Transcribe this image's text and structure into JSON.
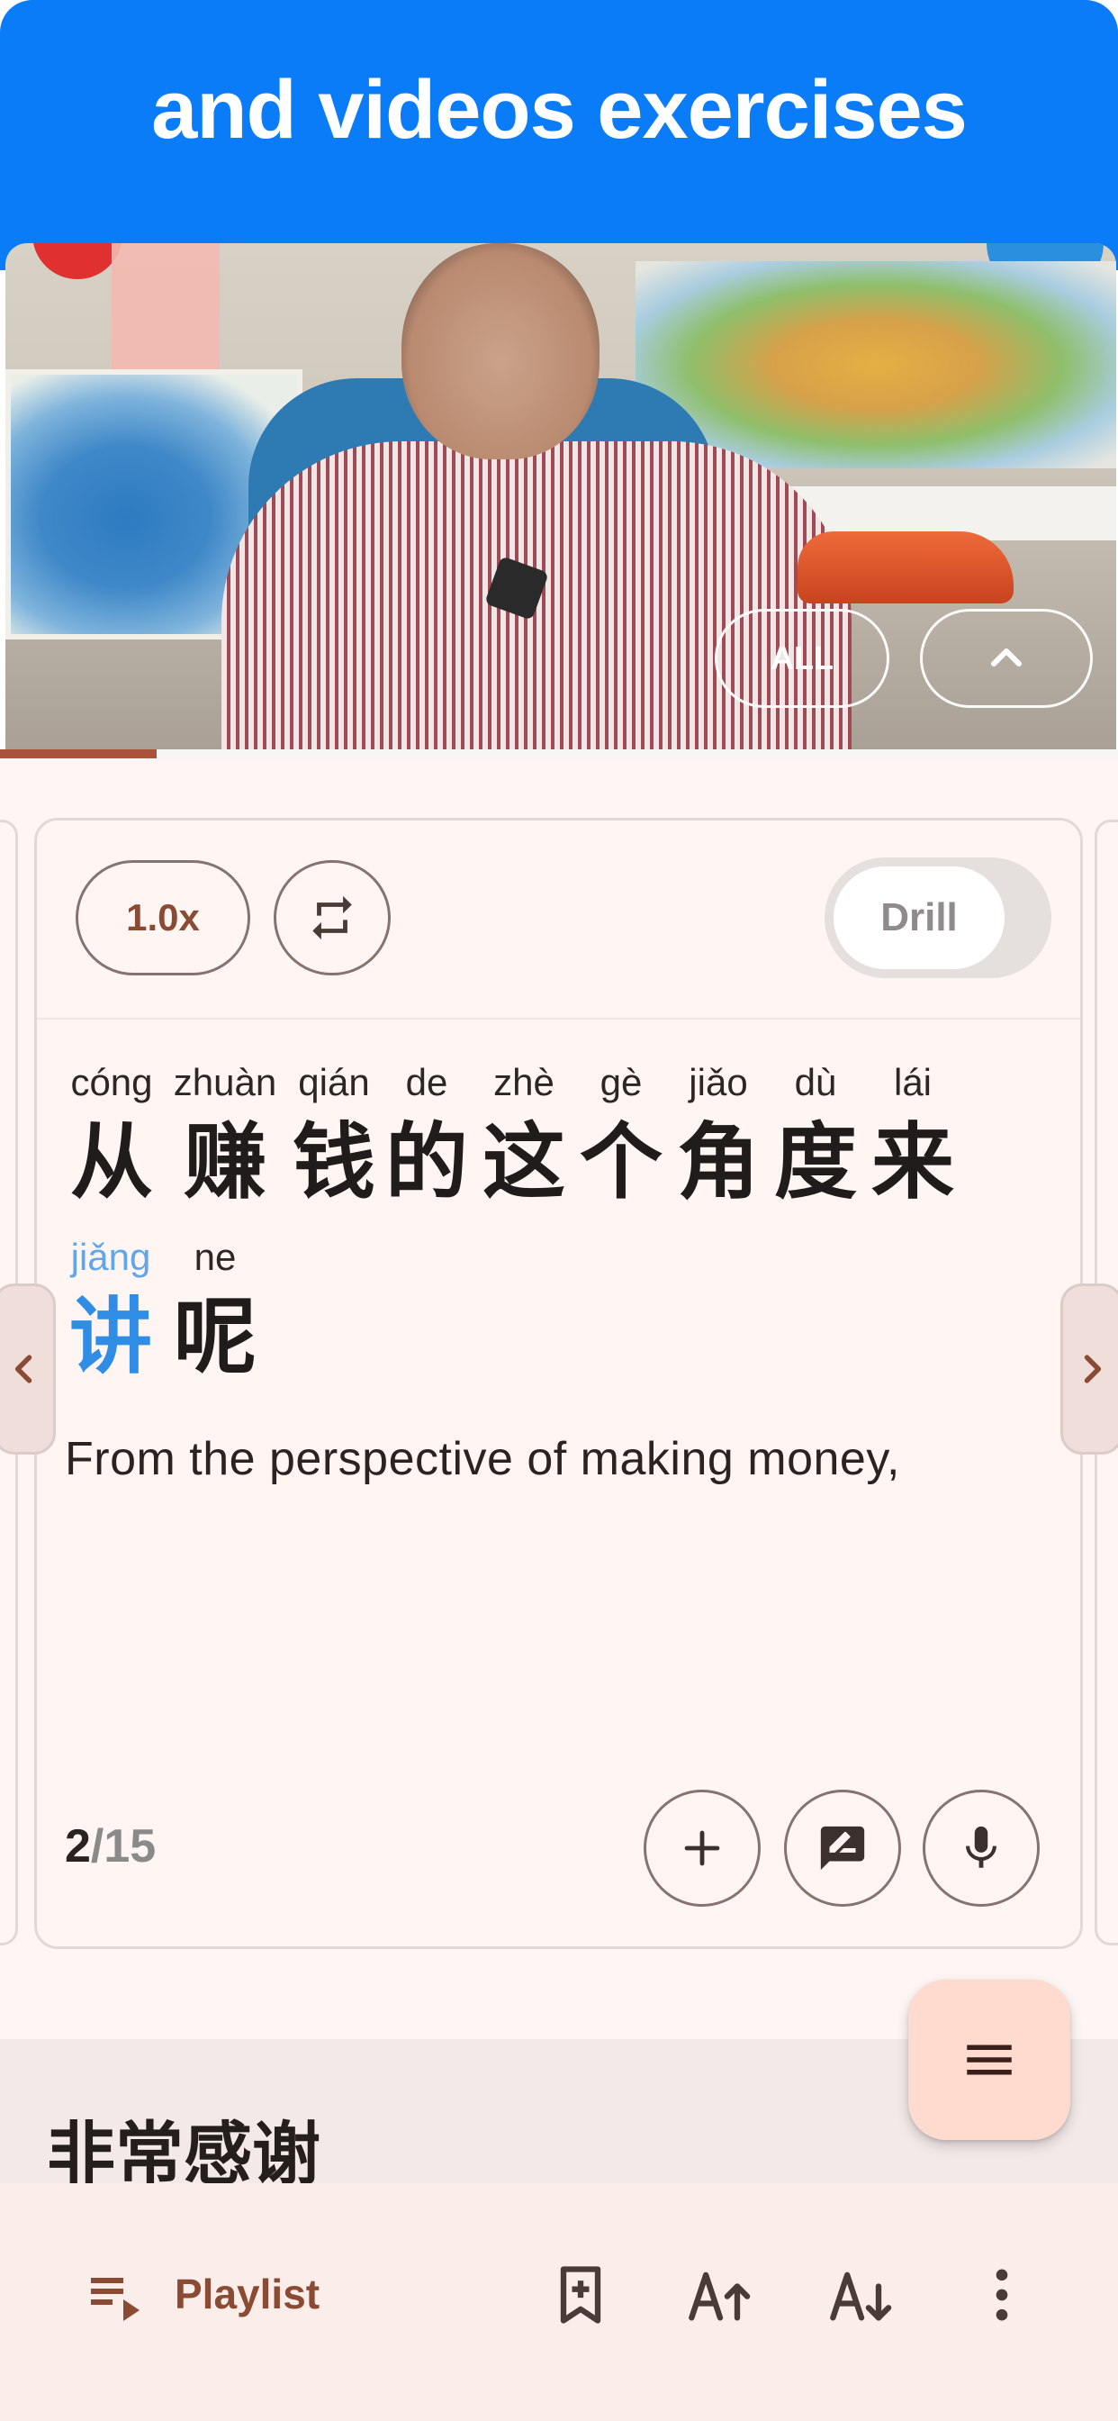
{
  "banner": {
    "title": "and videos exercises"
  },
  "video": {
    "overlay_all_label": "ALL",
    "collapse_icon": "chevron-up-icon",
    "progress_fraction": 0.14
  },
  "controls": {
    "speed_label": "1.0x",
    "repeat_icon": "repeat-icon",
    "drill_label": "Drill",
    "drill_on": false
  },
  "sentence": {
    "lines": [
      [
        {
          "pinyin": "cóng",
          "hanzi": "从"
        },
        {
          "pinyin": "zhuàn",
          "hanzi": "赚"
        },
        {
          "pinyin": "qián",
          "hanzi": "钱"
        },
        {
          "pinyin": "de",
          "hanzi": "的"
        },
        {
          "pinyin": "zhè",
          "hanzi": "这"
        },
        {
          "pinyin": "gè",
          "hanzi": "个"
        },
        {
          "pinyin": "jiǎo",
          "hanzi": "角"
        },
        {
          "pinyin": "dù",
          "hanzi": "度"
        },
        {
          "pinyin": "lái",
          "hanzi": "来"
        }
      ],
      [
        {
          "pinyin": "jiǎng",
          "hanzi": "讲",
          "highlight": true
        },
        {
          "pinyin": "ne",
          "hanzi": "呢"
        }
      ]
    ],
    "translation": "From the perspective of making money,"
  },
  "counter": {
    "current": "2",
    "total": "/15"
  },
  "actions": {
    "add_icon": "plus-icon",
    "edit_icon": "rate-review-icon",
    "mic_icon": "microphone-icon"
  },
  "next_section": {
    "title": "非常感谢"
  },
  "fab": {
    "icon": "menu-icon"
  },
  "bottom_bar": {
    "playlist_label": "Playlist",
    "icons": [
      "playlist-icon",
      "bookmark-add-icon",
      "font-size-increase-icon",
      "font-size-decrease-icon",
      "more-vertical-icon"
    ]
  },
  "colors": {
    "banner": "#0a7cf7",
    "accent": "#8b4a33",
    "highlight": "#2f8de6",
    "panel_bg": "#fef6f4",
    "bottom_bar_bg": "#fbede9",
    "fab_bg": "#ffdbcf"
  }
}
